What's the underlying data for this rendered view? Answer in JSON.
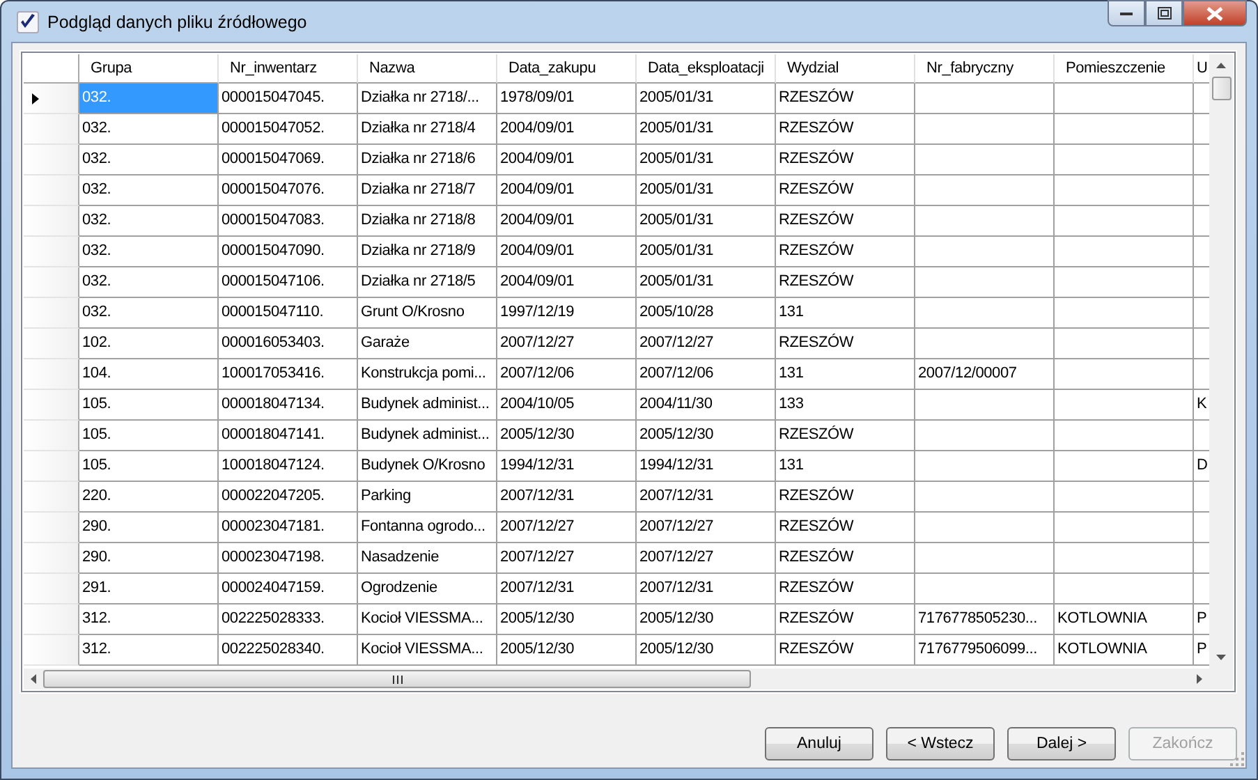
{
  "window": {
    "title": "Podgląd danych pliku źródłowego"
  },
  "table": {
    "columns": [
      "Grupa",
      "Nr_inwentarz",
      "Nazwa",
      "Data_zakupu",
      "Data_eksploatacji",
      "Wydzial",
      "Nr_fabryczny",
      "Pomieszczenie",
      "U"
    ],
    "rows": [
      {
        "current": true,
        "selected": true,
        "cells": [
          "032.",
          "000015047045.",
          "Działka nr 2718/...",
          "1978/09/01",
          "2005/01/31",
          "RZESZÓW",
          "",
          "",
          ""
        ]
      },
      {
        "current": false,
        "selected": false,
        "cells": [
          "032.",
          "000015047052.",
          "Działka nr 2718/4",
          "2004/09/01",
          "2005/01/31",
          "RZESZÓW",
          "",
          "",
          ""
        ]
      },
      {
        "current": false,
        "selected": false,
        "cells": [
          "032.",
          "000015047069.",
          "Działka nr 2718/6",
          "2004/09/01",
          "2005/01/31",
          "RZESZÓW",
          "",
          "",
          ""
        ]
      },
      {
        "current": false,
        "selected": false,
        "cells": [
          "032.",
          "000015047076.",
          "Działka nr 2718/7",
          "2004/09/01",
          "2005/01/31",
          "RZESZÓW",
          "",
          "",
          ""
        ]
      },
      {
        "current": false,
        "selected": false,
        "cells": [
          "032.",
          "000015047083.",
          "Działka nr 2718/8",
          "2004/09/01",
          "2005/01/31",
          "RZESZÓW",
          "",
          "",
          ""
        ]
      },
      {
        "current": false,
        "selected": false,
        "cells": [
          "032.",
          "000015047090.",
          "Działka nr 2718/9",
          "2004/09/01",
          "2005/01/31",
          "RZESZÓW",
          "",
          "",
          ""
        ]
      },
      {
        "current": false,
        "selected": false,
        "cells": [
          "032.",
          "000015047106.",
          "Działka nr 2718/5",
          "2004/09/01",
          "2005/01/31",
          "RZESZÓW",
          "",
          "",
          ""
        ]
      },
      {
        "current": false,
        "selected": false,
        "cells": [
          "032.",
          "000015047110.",
          "Grunt O/Krosno",
          "1997/12/19",
          "2005/10/28",
          "131",
          "",
          "",
          ""
        ]
      },
      {
        "current": false,
        "selected": false,
        "cells": [
          "102.",
          "000016053403.",
          "Garaże",
          "2007/12/27",
          "2007/12/27",
          "RZESZÓW",
          "",
          "",
          ""
        ]
      },
      {
        "current": false,
        "selected": false,
        "cells": [
          "104.",
          "100017053416.",
          "Konstrukcja pomi...",
          "2007/12/06",
          "2007/12/06",
          "131",
          "2007/12/00007",
          "",
          ""
        ]
      },
      {
        "current": false,
        "selected": false,
        "cells": [
          "105.",
          "000018047134.",
          "Budynek administ...",
          "2004/10/05",
          "2004/11/30",
          "133",
          "",
          "",
          "K"
        ]
      },
      {
        "current": false,
        "selected": false,
        "cells": [
          "105.",
          "000018047141.",
          "Budynek administ...",
          "2005/12/30",
          "2005/12/30",
          "RZESZÓW",
          "",
          "",
          ""
        ]
      },
      {
        "current": false,
        "selected": false,
        "cells": [
          "105.",
          "100018047124.",
          "Budynek O/Krosno",
          "1994/12/31",
          "1994/12/31",
          "131",
          "",
          "",
          "D"
        ]
      },
      {
        "current": false,
        "selected": false,
        "cells": [
          "220.",
          "000022047205.",
          "Parking",
          "2007/12/31",
          "2007/12/31",
          "RZESZÓW",
          "",
          "",
          ""
        ]
      },
      {
        "current": false,
        "selected": false,
        "cells": [
          "290.",
          "000023047181.",
          "Fontanna ogrodo...",
          "2007/12/27",
          "2007/12/27",
          "RZESZÓW",
          "",
          "",
          ""
        ]
      },
      {
        "current": false,
        "selected": false,
        "cells": [
          "290.",
          "000023047198.",
          "Nasadzenie",
          "2007/12/27",
          "2007/12/27",
          "RZESZÓW",
          "",
          "",
          ""
        ]
      },
      {
        "current": false,
        "selected": false,
        "cells": [
          "291.",
          "000024047159.",
          "Ogrodzenie",
          "2007/12/31",
          "2007/12/31",
          "RZESZÓW",
          "",
          "",
          ""
        ]
      },
      {
        "current": false,
        "selected": false,
        "cells": [
          "312.",
          "002225028333.",
          "Kocioł VIESSMA...",
          "2005/12/30",
          "2005/12/30",
          "RZESZÓW",
          "7176778505230...",
          "KOTLOWNIA",
          "P"
        ]
      },
      {
        "current": false,
        "selected": false,
        "cells": [
          "312.",
          "002225028340.",
          "Kocioł VIESSMA...",
          "2005/12/30",
          "2005/12/30",
          "RZESZÓW",
          "7176779506099...",
          "KOTLOWNIA",
          "P"
        ]
      }
    ]
  },
  "buttons": [
    {
      "label": "Anuluj",
      "disabled": false
    },
    {
      "label": "< Wstecz",
      "disabled": false
    },
    {
      "label": "Dalej >",
      "disabled": false
    },
    {
      "label": "Zakończ",
      "disabled": true
    }
  ]
}
